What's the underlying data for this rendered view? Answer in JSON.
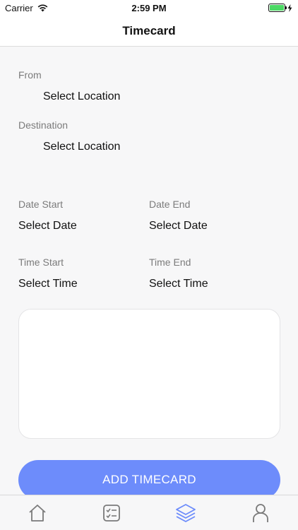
{
  "status_bar": {
    "carrier": "Carrier",
    "time": "2:59 PM",
    "wifi_icon": "wifi-icon",
    "battery_icon": "battery-icon",
    "battery_level": 1.0,
    "charging_icon": "bolt-icon"
  },
  "header": {
    "title": "Timecard"
  },
  "form": {
    "from": {
      "label": "From",
      "value": "Select Location"
    },
    "destination": {
      "label": "Destination",
      "value": "Select Location"
    },
    "date_start": {
      "label": "Date Start",
      "value": "Select Date"
    },
    "date_end": {
      "label": "Date End",
      "value": "Select Date"
    },
    "time_start": {
      "label": "Time Start",
      "value": "Select Time"
    },
    "time_end": {
      "label": "Time End",
      "value": "Select Time"
    },
    "notes": {
      "value": ""
    }
  },
  "actions": {
    "add_label": "ADD TIMECARD"
  },
  "colors": {
    "accent": "#6d8cfb",
    "active_tab": "#6d8cfb",
    "inactive_tab": "#7a7a7a",
    "label": "#7b7b7b"
  },
  "tab_bar": {
    "items": [
      {
        "icon": "home-icon",
        "active": false
      },
      {
        "icon": "checklist-icon",
        "active": false
      },
      {
        "icon": "layers-icon",
        "active": true
      },
      {
        "icon": "user-icon",
        "active": false
      }
    ]
  }
}
